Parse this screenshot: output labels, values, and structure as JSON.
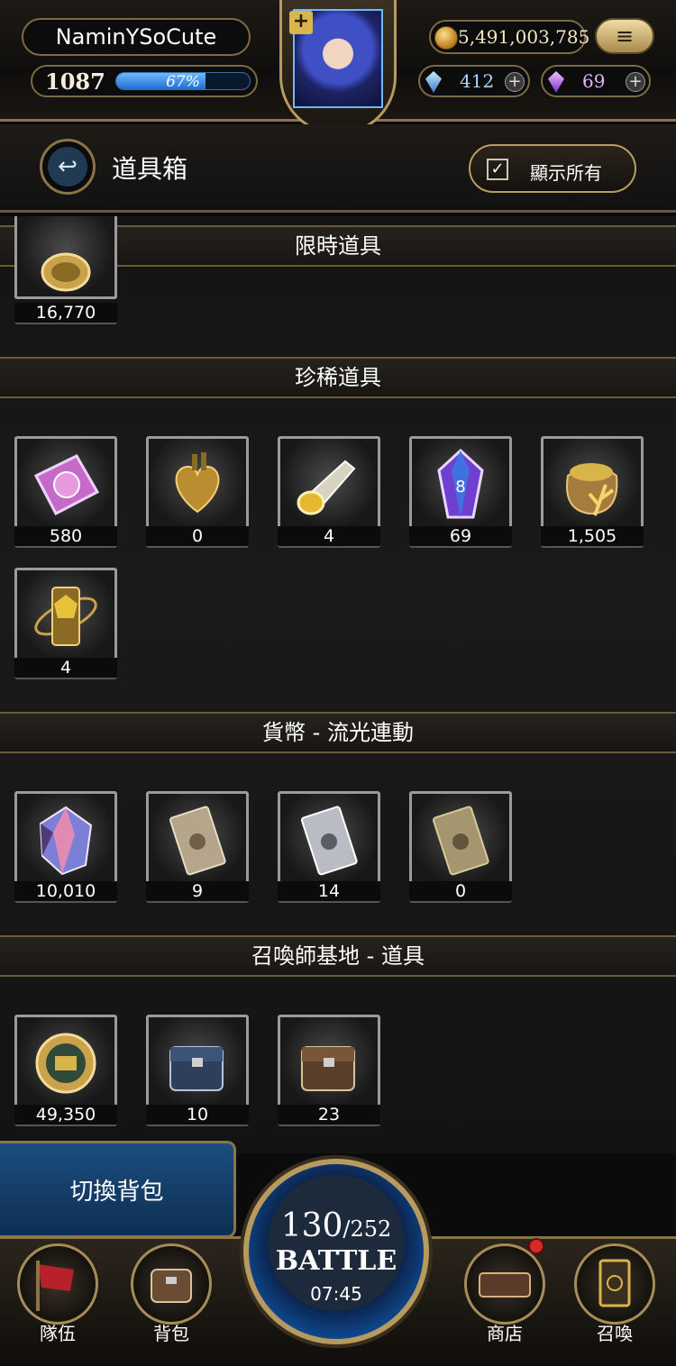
{
  "header": {
    "player_name": "NaminYSoCute",
    "level": "1087",
    "xp_percent_label": "67%",
    "xp_fraction": 0.67,
    "gold": "5,491,003,785",
    "blue_gems": "412",
    "purple_gems": "69",
    "avatar_plus": "+",
    "menu_icon": "≡"
  },
  "title_bar": {
    "title": "道具箱",
    "show_all_label": "顯示所有",
    "show_all_checked": true
  },
  "sections": [
    {
      "title": "限時道具",
      "items": [
        {
          "icon": "gold-seal-icon",
          "count": "16,770"
        }
      ]
    },
    {
      "title": "珍稀道具",
      "items": [
        {
          "icon": "pink-crystal-card-icon",
          "count": "580"
        },
        {
          "icon": "golden-heart-icon",
          "count": "0"
        },
        {
          "icon": "golden-horn-icon",
          "count": "4"
        },
        {
          "icon": "purple-crystal-icon",
          "count": "69"
        },
        {
          "icon": "seed-sack-icon",
          "count": "1,505"
        },
        {
          "icon": "golden-orbit-relic-icon",
          "count": "4"
        }
      ]
    },
    {
      "title": "貨幣 - 流光連動",
      "items": [
        {
          "icon": "iridescent-gem-icon",
          "count": "10,010"
        },
        {
          "icon": "bronze-ticket-icon",
          "count": "9"
        },
        {
          "icon": "silver-ticket-icon",
          "count": "14"
        },
        {
          "icon": "gold-ticket-icon",
          "count": "0"
        }
      ]
    },
    {
      "title": "召喚師基地 - 道具",
      "items": [
        {
          "icon": "throne-medal-icon",
          "count": "49,350"
        },
        {
          "icon": "blue-backpack-icon",
          "count": "10"
        },
        {
          "icon": "brown-backpack-icon",
          "count": "23"
        }
      ]
    }
  ],
  "bottom": {
    "switch_bag": "切換背包",
    "stamina_current": "130",
    "stamina_max": "/252",
    "battle_label": "BATTLE",
    "timer": "07:45",
    "nav": [
      {
        "label": "隊伍",
        "icon": "red-flag-icon"
      },
      {
        "label": "背包",
        "icon": "backpack-icon"
      },
      {
        "label": "商店",
        "icon": "shop-sign-icon",
        "notification": true
      },
      {
        "label": "召喚",
        "icon": "summon-card-icon"
      }
    ]
  }
}
